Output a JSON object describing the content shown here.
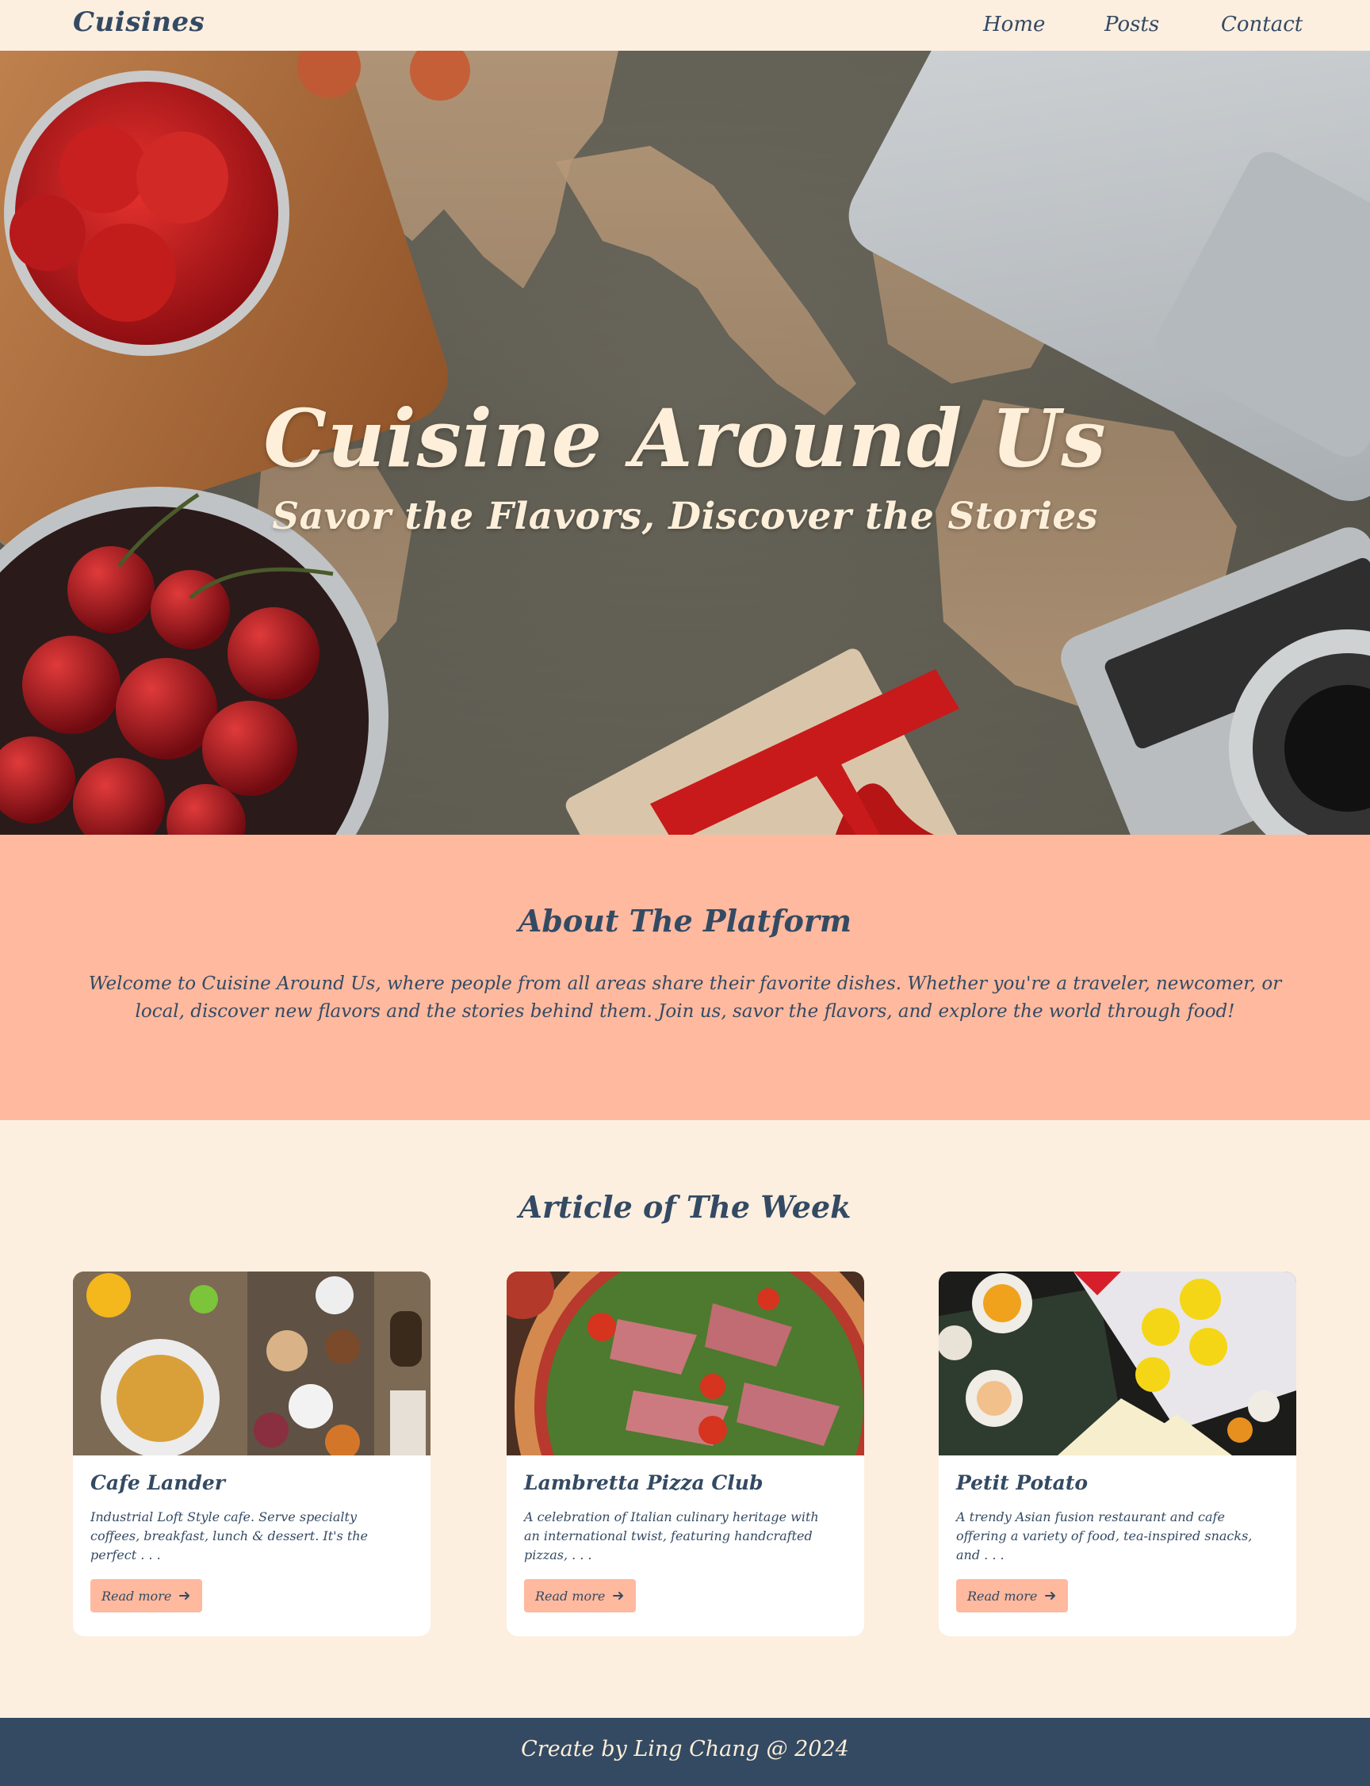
{
  "nav": {
    "brand": "Cuisines",
    "links": [
      "Home",
      "Posts",
      "Contact"
    ]
  },
  "hero": {
    "title": "Cuisine Around Us",
    "subtitle": "Savor the Flavors, Discover the Stories"
  },
  "about": {
    "title": "About The Platform",
    "text": "Welcome to Cuisine Around Us, where people from all areas share their favorite dishes. Whether you're a traveler, newcomer, or local, discover new flavors and the stories behind them. Join us, savor the flavors, and explore the world through food!"
  },
  "articles": {
    "title": "Article of The Week",
    "cards": [
      {
        "title": "Cafe Lander",
        "description": "Industrial Loft Style cafe. Serve specialty coffees, breakfast, lunch & dessert. It's the perfect . . .",
        "button": "Read more"
      },
      {
        "title": "Lambretta Pizza Club",
        "description": "A celebration of Italian culinary heritage with an international twist, featuring handcrafted pizzas, . . .",
        "button": "Read more"
      },
      {
        "title": "Petit Potato",
        "description": "A trendy Asian fusion restaurant and cafe offering a variety of food, tea-inspired snacks, and . . .",
        "button": "Read more"
      }
    ]
  },
  "footer": {
    "text": "Create by Ling Chang @ 2024"
  },
  "colors": {
    "background": "#fcefe0",
    "accent": "#ffb99e",
    "navy": "#344a63",
    "hero_text": "#fdefd9",
    "card": "#ffffff"
  },
  "icons": [
    "arrow-right-icon"
  ]
}
